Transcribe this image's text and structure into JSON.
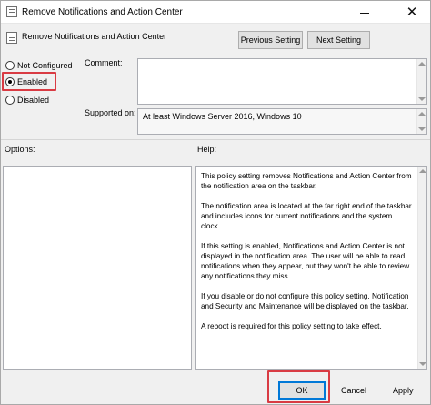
{
  "window": {
    "title": "Remove Notifications and Action Center",
    "minimize_icon": "minimize-icon",
    "close_icon": "close-icon",
    "close_glyph": "✕"
  },
  "header": {
    "setting_name": "Remove Notifications and Action Center",
    "previous_label": "Previous Setting",
    "next_label": "Next Setting"
  },
  "state": {
    "options": [
      {
        "label": "Not Configured",
        "checked": false
      },
      {
        "label": "Enabled",
        "checked": true
      },
      {
        "label": "Disabled",
        "checked": false
      }
    ]
  },
  "fields": {
    "comment_label": "Comment:",
    "comment_value": "",
    "supported_label": "Supported on:",
    "supported_value": "At least Windows Server 2016, Windows 10"
  },
  "panels": {
    "options_label": "Options:",
    "help_label": "Help:",
    "help_paragraphs": [
      "This policy setting removes Notifications and Action Center from the notification area on the taskbar.",
      "The notification area is located at the far right end of the taskbar and includes icons for current notifications and the system clock.",
      "If this setting is enabled, Notifications and Action Center is not displayed in the notification area. The user will be able to read notifications when they appear, but they won't be able to review any notifications they miss.",
      "If you disable or do not configure this policy setting, Notification and Security and Maintenance will be displayed on the taskbar.",
      "A reboot is required for this policy setting to take effect."
    ]
  },
  "footer": {
    "ok_label": "OK",
    "cancel_label": "Cancel",
    "apply_label": "Apply"
  },
  "colors": {
    "highlight": "#d93b43",
    "window_bg": "#f0f0f0",
    "button_bg": "#e1e1e1"
  }
}
